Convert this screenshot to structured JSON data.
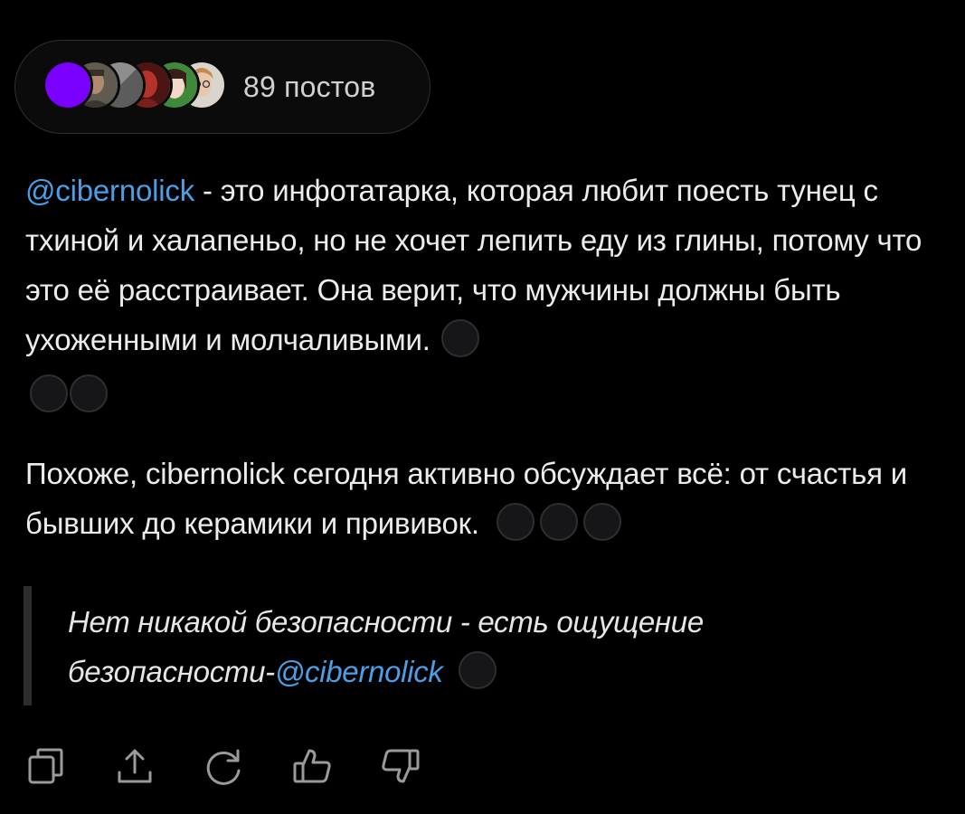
{
  "header": {
    "posts_count": "89 постов",
    "avatars": [
      {
        "name": "avatar-purple",
        "color": "#7a00ff"
      },
      {
        "name": "avatar-man-photo",
        "color": "#6d6a5c"
      },
      {
        "name": "avatar-gray",
        "color": "#8e8e8e"
      },
      {
        "name": "avatar-red-figure",
        "color": "#9a2a24"
      },
      {
        "name": "avatar-anime-girl",
        "color": "#3e8a3a"
      },
      {
        "name": "avatar-glasses-woman",
        "color": "#d9d4cc"
      }
    ]
  },
  "post": {
    "paragraph1": {
      "mention": "@cibernolick",
      "text": " - это инфотатарка, которая любит поесть тунец с тхиной и халапеньо, но не хочет лепить еду из глины, потому что это её расстраивает. Она верит, что мужчины должны быть ухоженными и молчаливыми."
    },
    "paragraph2": {
      "text": "Похоже, cibernolick сегодня активно обсуждает всё: от счастья и бывших до керамики и прививок."
    },
    "quote": {
      "text": "Нет никакой безопасности - есть ощущение безопасности-",
      "mention": "@cibernolick"
    }
  },
  "actions": [
    {
      "name": "copy-icon"
    },
    {
      "name": "share-icon"
    },
    {
      "name": "refresh-icon"
    },
    {
      "name": "thumbs-up-icon"
    },
    {
      "name": "thumbs-down-icon"
    }
  ],
  "colors": {
    "background": "#000000",
    "text": "#ececec",
    "mention": "#4a9fe6",
    "quote_bar": "#2d2d30",
    "pill_border": "#2f2f33"
  }
}
